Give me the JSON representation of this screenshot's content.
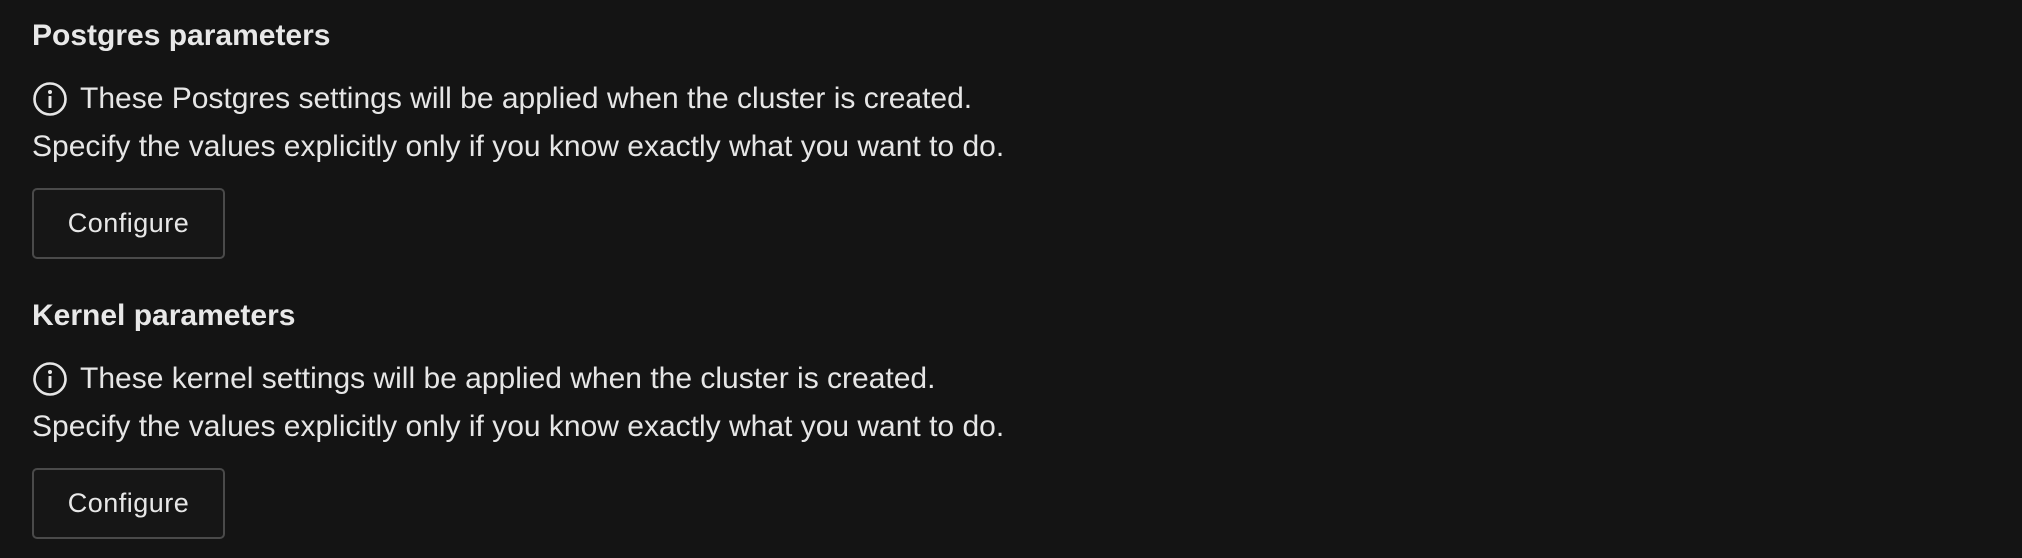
{
  "postgres": {
    "title": "Postgres parameters",
    "info_icon": "info-circle-icon",
    "info_text": "These Postgres settings will be applied when the cluster is created.",
    "sub_text": "Specify the values explicitly only if you know exactly what you want to do.",
    "button_label": "Configure"
  },
  "kernel": {
    "title": "Kernel parameters",
    "info_icon": "info-circle-icon",
    "info_text": "These kernel settings will be applied when the cluster is created.",
    "sub_text": "Specify the values explicitly only if you know exactly what you want to do.",
    "button_label": "Configure"
  },
  "colors": {
    "background": "#141414",
    "text": "#e6e6e6",
    "button_border": "#4a4a4a"
  }
}
